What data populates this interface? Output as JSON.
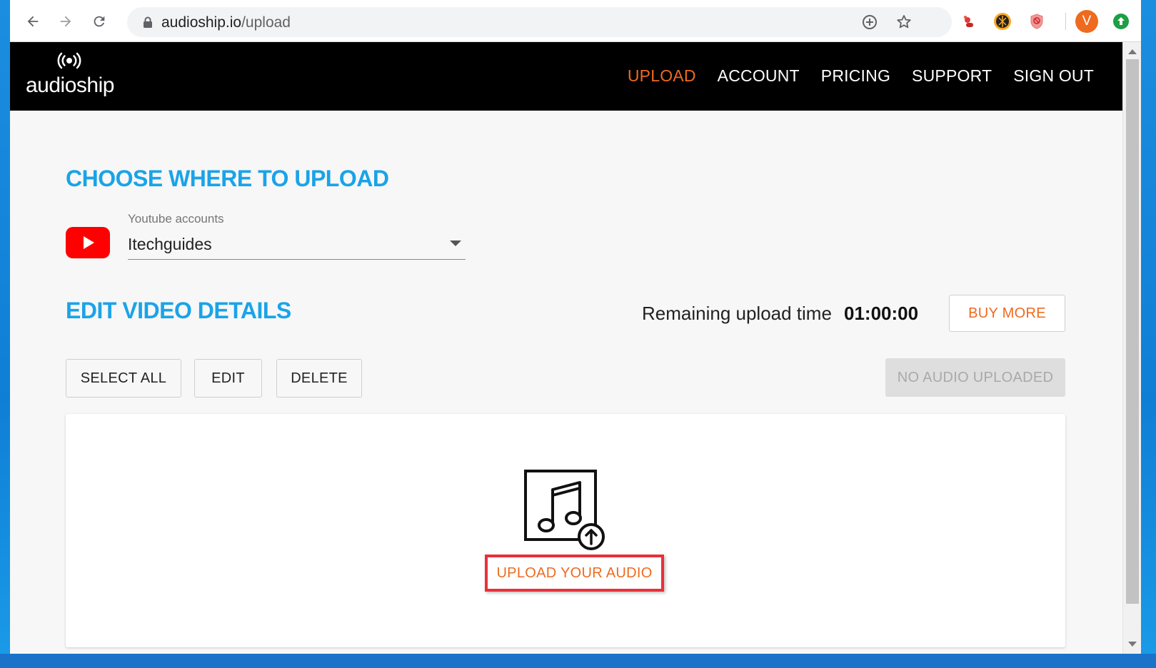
{
  "browser": {
    "url_host": "audioship.io",
    "url_path": "/upload"
  },
  "site": {
    "logo_text": "audioship",
    "nav": [
      {
        "label": "UPLOAD",
        "active": true
      },
      {
        "label": "ACCOUNT",
        "active": false
      },
      {
        "label": "PRICING",
        "active": false
      },
      {
        "label": "SUPPORT",
        "active": false
      },
      {
        "label": "SIGN OUT",
        "active": false
      }
    ]
  },
  "choose": {
    "heading": "CHOOSE WHERE TO UPLOAD",
    "select_label": "Youtube accounts",
    "select_value": "Itechguides"
  },
  "edit": {
    "heading": "EDIT VIDEO DETAILS",
    "remaining_label": "Remaining upload time",
    "remaining_value": "01:00:00",
    "buy_more": "BUY MORE",
    "select_all": "SELECT ALL",
    "edit": "EDIT",
    "delete": "DELETE",
    "no_audio": "NO AUDIO UPLOADED"
  },
  "upload": {
    "link_label": "UPLOAD YOUR AUDIO"
  },
  "user": {
    "avatar_letter": "V"
  },
  "colors": {
    "accent_orange": "#ee6a1f",
    "heading_blue": "#1aa3e8",
    "highlight_red": "#e8303a",
    "youtube_red": "#ff0000"
  }
}
